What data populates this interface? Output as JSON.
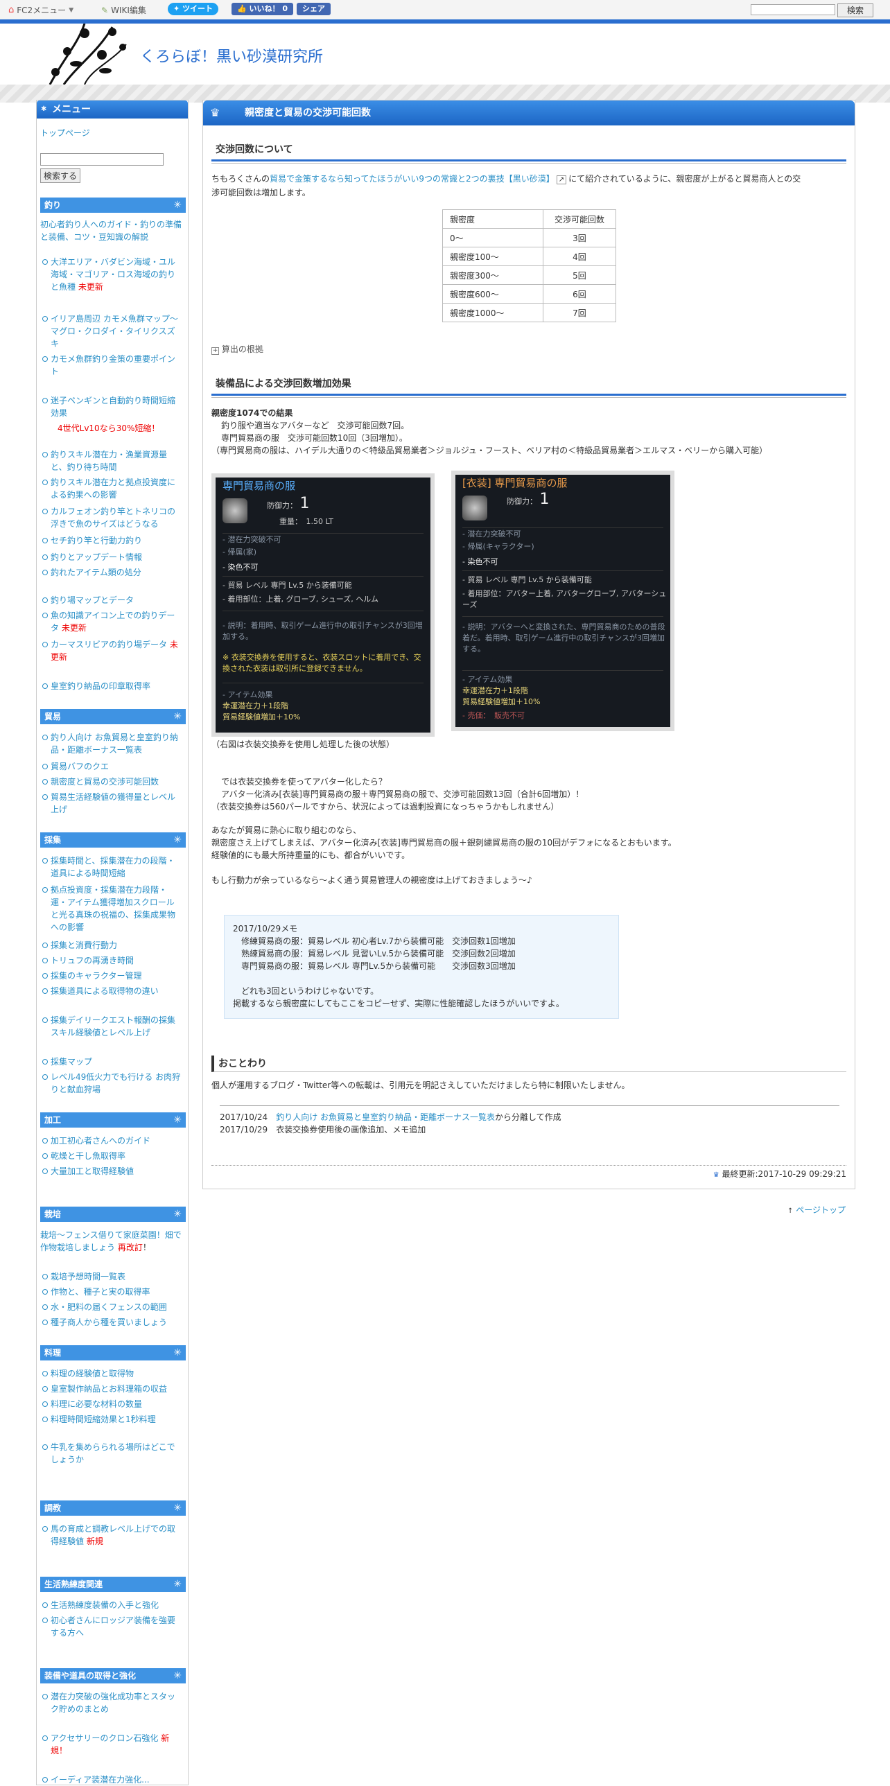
{
  "topbar": {
    "fc2_menu": "FC2メニュー",
    "wiki_edit": "WIKI編集",
    "tweet": "ツイート",
    "like": "いいね！ 0",
    "share": "シェア",
    "search_button": "検索"
  },
  "site": {
    "title": "くろらぼ！黒い砂漠研究所"
  },
  "sidebar": {
    "menu_title": "メニュー",
    "top_page": "トップページ",
    "search_button": "検索する",
    "sections": {
      "fishing": "釣り",
      "trade": "貿易",
      "gathering": "採集",
      "processing": "加工",
      "farming": "栽培",
      "cooking": "料理",
      "training": "調教",
      "life_skill": "生活熟練度関連",
      "equipment": "装備や道具の取得と強化"
    },
    "fishing_intro": "初心者釣り人へのガイド・釣りの準備と装備、コツ・豆知識の解説",
    "fishing_items": [
      "大洋エリア・バダビン海域・ユル海域・マゴリア・ロス海域の釣りと魚種",
      "イリア島周辺 カモメ魚群マップ～マグロ・クロダイ・タイリクスズキ",
      "カモメ魚群釣り金策の重要ポイント",
      "迷子ペンギンと自動釣り時間短縮効果",
      "釣りスキル潜在力・漁業資源量と、釣り待ち時間",
      "釣りスキル潜在力と拠点投資度による釣果への影響",
      "カルフェオン釣り竿とトネリコの浮きで魚のサイズはどうなる",
      "セチ釣り竿と行動力釣り",
      "釣りとアップデート情報",
      "釣れたアイテム類の処分",
      "釣り場マップとデータ",
      "魚の知識アイコン上での釣りデータ",
      "カーマスリビアの釣り場データ",
      "皇室釣り納品の印章取得率"
    ],
    "fishing_new1": "未更新",
    "fishing_note": "4世代Lv10なら30%短縮！",
    "fishing_new2": "未更新",
    "fishing_new3": "未更新",
    "trade_items": [
      "釣り人向け お魚貿易と皇室釣り納品・距離ボーナス一覧表",
      "貿易バフのクエ",
      "親密度と貿易の交渉可能回数",
      "貿易生活経験値の獲得量とレベル上げ"
    ],
    "gathering_items": [
      "採集時間と、採集潜在力の段階・道具による時間短縮",
      "拠点投資度・採集潜在力段階・運・アイテム獲得増加スクロールと光る真珠の祝福の、採集成果物への影響",
      "採集と消費行動力",
      "トリュフの再湧き時間",
      "採集のキャラクター管理",
      "採集道具による取得物の違い",
      "採集デイリークエスト報酬の採集スキル経験値とレベル上げ",
      "採集マップ",
      "レベル49低火力でも行ける お肉狩りと献血狩場"
    ],
    "processing_items": [
      "加工初心者さんへのガイド",
      "乾燥と干し魚取得率",
      "大量加工と取得経験値"
    ],
    "farming_intro": "栽培～フェンス借りて家庭菜園！畑で作物栽培しましょう",
    "farming_tag": "再改訂",
    "farming_items": [
      "栽培予想時間一覧表",
      "作物と、種子と実の取得率",
      "水・肥料の届くフェンスの範囲",
      "種子商人から種を買いましょう"
    ],
    "cooking_items": [
      "料理の経験値と取得物",
      "皇室製作納品とお料理箱の収益",
      "料理に必要な材料の数量",
      "料理時間短縮効果と1秒料理",
      "牛乳を集めらられる場所はどこでしょうか"
    ],
    "training_items": [
      "馬の育成と調教レベル上げでの取得経験値"
    ],
    "training_tag": "新規",
    "life_items": [
      "生活熟練度装備の入手と強化",
      "初心者さんにロッジア装備を強要する方へ"
    ],
    "equipment_items": [
      "潜在力突破の強化成功率とスタック貯めのまとめ",
      "アクセサリーのクロン石強化"
    ],
    "equipment_tag": "新規！",
    "equipment_cut": "イーディア装潜在力強化..."
  },
  "main": {
    "title": "親密度と貿易の交渉可能回数",
    "section1": "交渉回数について",
    "intro_prefix": "ちもろくさんの",
    "intro_link": "貿易で金策するなら知ってたほうがいい9つの常識と2つの裏技【黒い砂漠】",
    "intro_suffix1": "にて紹介されているように、親密度が上がると貿易商人との交",
    "intro_suffix2": "渉可能回数は増加します。",
    "table_header": [
      "親密度",
      "交渉可能回数"
    ],
    "table_rows": [
      [
        "0～",
        "3回"
      ],
      [
        "親密度100～",
        "4回"
      ],
      [
        "親密度300～",
        "5回"
      ],
      [
        "親密度600～",
        "6回"
      ],
      [
        "親密度1000～",
        "7回"
      ]
    ],
    "calc_basis": "算出の根拠",
    "section2": "装備品による交渉回数増加効果",
    "result_title": "親密度1074での結果",
    "result_lines": [
      "釣り服や適当なアバターなど　交渉可能回数7回。",
      "専門貿易商の服　交渉可能回数10回（3回増加）。",
      "（専門貿易商の服は、ハイデル大通りの＜特級品貿易業者＞ジョルジュ・フースト、ベリア村の＜特級品貿易業者＞エルマス・ベリーから購入可能）"
    ],
    "card1": {
      "title": "専門貿易商の服",
      "defense": "防御力：",
      "defense_val": "1",
      "weight": "重量：　1.50 LT",
      "lines": [
        "- 潜在力突破不可",
        "- 帰属(家)",
        "- 染色不可",
        "- 貿易 レベル 専門 Lv.5 から装備可能",
        "- 着用部位：上着, グローブ, シューズ, ヘルム"
      ],
      "desc": "- 説明：着用時、取引ゲーム進行中の取引チャンスが3回増加する。",
      "notice": "※ 衣装交換券を使用すると、衣装スロットに着用でき、交換された衣装は取引所に登録できません。",
      "effect_head": "- アイテム効果",
      "effects": [
        "幸運潜在力＋1段階",
        "貿易経験値増加＋10%"
      ]
    },
    "card2": {
      "title": "[衣装] 専門貿易商の服",
      "defense": "防御力：",
      "defense_val": "1",
      "lines": [
        "- 潜在力突破不可",
        "- 帰属(キャラクター)",
        "- 染色不可",
        "- 貿易 レベル 専門 Lv.5 から装備可能",
        "- 着用部位：アバター上着, アバターグローブ, アバターシューズ"
      ],
      "desc": "- 説明：アバターへと変換された、専門貿易商のための普段着だ。着用時、取引ゲーム進行中の取引チャンスが3回増加する。",
      "effect_head": "- アイテム効果",
      "effects": [
        "幸運潜在力＋1段階",
        "貿易経験値増加＋10%"
      ],
      "sale": "- 売価：　販売不可"
    },
    "caption": "（右図は衣装交換券を使用し処理した後の状態）",
    "para2": [
      "では衣装交換券を使ってアバター化したら？",
      "アバター化済み[衣装]専門貿易商の服＋専門貿易商の服で、交渉可能回数13回（合計6回増加）！",
      "（衣装交換券は560パールですから、状況によっては過剰投資になっちゃうかもしれません）"
    ],
    "para3": [
      "あなたが貿易に熱心に取り組むのなら、",
      "親密度さえ上げてしまえば、アバター化済み[衣装]専門貿易商の服＋銀刺繍貿易商の服の10回がデフォになるとおもいます。",
      "経験値的にも最大所持重量的にも、都合がいいです。"
    ],
    "para4": "もし行動力が余っているなら～よく通う貿易管理人の親密度は上げておきましょう～♪",
    "memo": {
      "title": "2017/10/29メモ",
      "lines": [
        "修練貿易商の服：貿易レベル 初心者Lv.7から装備可能　交渉回数1回増加",
        "熟練貿易商の服：貿易レベル 見習いLv.5から装備可能　交渉回数2回増加",
        "専門貿易商の服：貿易レベル 専門Lv.5から装備可能　　交渉回数3回増加"
      ],
      "note1": "どれも3回というわけじゃないです。",
      "note2": "掲載するなら親密度にしてもここをコピーせず、実際に性能確認したほうがいいですよ。"
    },
    "ending_title": "おことわり",
    "ending_text": "個人が運用するブログ・Twitter等への転載は、引用元を明記さえしていただけましたら特に制限いたしません。",
    "history": [
      {
        "date": "2017/10/24",
        "link": "釣り人向け お魚貿易と皇室釣り納品・距離ボーナス一覧表",
        "text": "から分離して作成"
      },
      {
        "date": "2017/10/29",
        "link": "",
        "text": "衣装交換券使用後の画像追加、メモ追加"
      }
    ],
    "last_updated": "最終更新:2017-10-29 09:29:21"
  },
  "page_top": "ページトップ"
}
